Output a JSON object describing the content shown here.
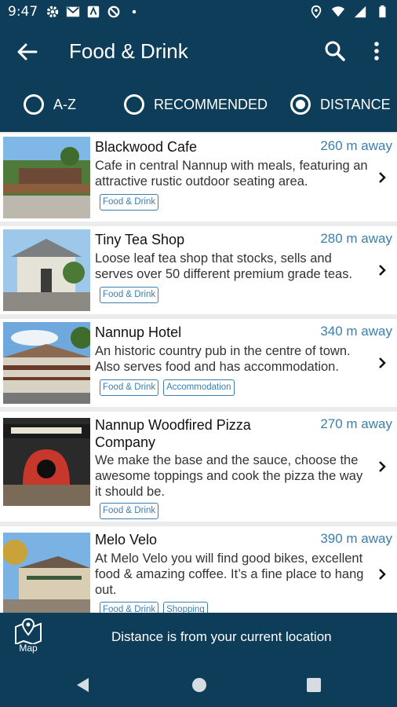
{
  "status": {
    "time": "9:47"
  },
  "appbar": {
    "title": "Food & Drink"
  },
  "sort": {
    "options": [
      {
        "label": "A-Z",
        "selected": false
      },
      {
        "label": "RECOMMENDED",
        "selected": false
      },
      {
        "label": "DISTANCE",
        "selected": true
      }
    ]
  },
  "items": [
    {
      "name": "Blackwood Cafe",
      "distance": "260 m away",
      "description": "Cafe in central Nannup with meals, featuring an attractive rustic outdoor seating area.",
      "tags": [
        "Food & Drink"
      ]
    },
    {
      "name": "Tiny Tea Shop",
      "distance": "280 m away",
      "description": "Loose leaf tea shop that stocks, sells and serves over 50 different premium grade teas.",
      "tags": [
        "Food & Drink"
      ]
    },
    {
      "name": "Nannup Hotel",
      "distance": "340 m away",
      "description": "An historic country pub in the centre of town. Also serves food and has accommodation.",
      "tags": [
        "Food & Drink",
        "Accommodation"
      ]
    },
    {
      "name": "Nannup Woodfired Pizza Company",
      "distance": "270 m away",
      "description": "We make the base and the sauce, choose the awesome toppings and cook the pizza the way it should be.",
      "tags": [
        "Food & Drink"
      ]
    },
    {
      "name": "Melo Velo",
      "distance": "390 m away",
      "description": "At Melo Velo you will find good bikes, excellent food & amazing coffee. It’s a fine place to hang out.",
      "tags": [
        "Food & Drink",
        "Shopping"
      ]
    }
  ],
  "bottom": {
    "map_label": "Map",
    "note": "Distance is from your current location"
  },
  "colors": {
    "primary": "#0d3d58",
    "accent": "#3a7fb0"
  }
}
